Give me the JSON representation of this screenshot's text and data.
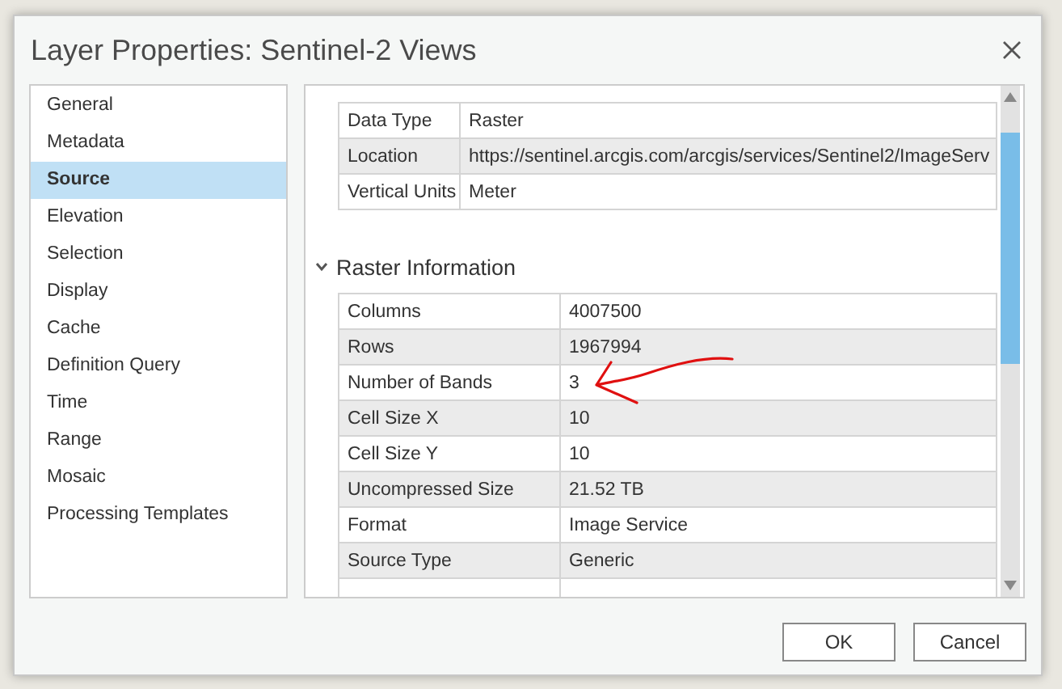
{
  "window": {
    "title": "Layer Properties: Sentinel-2 Views"
  },
  "sidebar": {
    "items": [
      {
        "label": "General",
        "selected": false
      },
      {
        "label": "Metadata",
        "selected": false
      },
      {
        "label": "Source",
        "selected": true
      },
      {
        "label": "Elevation",
        "selected": false
      },
      {
        "label": "Selection",
        "selected": false
      },
      {
        "label": "Display",
        "selected": false
      },
      {
        "label": "Cache",
        "selected": false
      },
      {
        "label": "Definition Query",
        "selected": false
      },
      {
        "label": "Time",
        "selected": false
      },
      {
        "label": "Range",
        "selected": false
      },
      {
        "label": "Mosaic",
        "selected": false
      },
      {
        "label": "Processing Templates",
        "selected": false
      }
    ]
  },
  "source_table": {
    "rows": [
      {
        "label": "Data Type",
        "value": "Raster"
      },
      {
        "label": "Location",
        "value": "https://sentinel.arcgis.com/arcgis/services/Sentinel2/ImageServ"
      },
      {
        "label": "Vertical Units",
        "value": "Meter"
      }
    ]
  },
  "raster_section": {
    "title": "Raster Information",
    "expanded": true,
    "rows": [
      {
        "label": "Columns",
        "value": "4007500"
      },
      {
        "label": "Rows",
        "value": "1967994"
      },
      {
        "label": "Number of Bands",
        "value": "3"
      },
      {
        "label": "Cell Size X",
        "value": "10"
      },
      {
        "label": "Cell Size Y",
        "value": "10"
      },
      {
        "label": "Uncompressed Size",
        "value": "21.52 TB"
      },
      {
        "label": "Format",
        "value": "Image Service"
      },
      {
        "label": "Source Type",
        "value": "Generic"
      }
    ]
  },
  "buttons": [
    "OK",
    "Cancel"
  ]
}
